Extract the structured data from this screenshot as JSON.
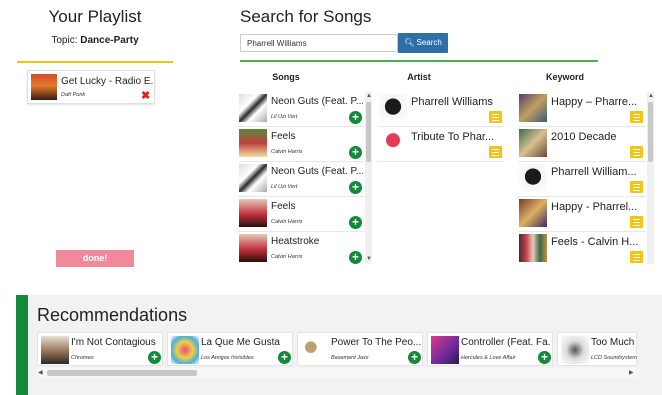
{
  "playlist": {
    "title": "Your Playlist",
    "topic_label": "Topic: ",
    "topic_value": "Dance-Party",
    "items": [
      {
        "title": "Get Lucky - Radio E...",
        "artist": "Daft Punk"
      }
    ],
    "done_label": "done!"
  },
  "search": {
    "title": "Search for Songs",
    "query": "Pharrell Williams",
    "button_label": "Search",
    "columns": {
      "songs": "Songs",
      "artist": "Artist",
      "keyword": "Keyword"
    },
    "songs": [
      {
        "title": "Neon Guts (Feat. P...",
        "artist": "Lil Uzi Vert"
      },
      {
        "title": "Feels",
        "artist": "Calvin Harris"
      },
      {
        "title": "Neon Guts (Feat. P...",
        "artist": "Lil Uzi Vert"
      },
      {
        "title": "Feels",
        "artist": "Calvin Harris"
      },
      {
        "title": "Heatstroke",
        "artist": "Calvin Harris"
      }
    ],
    "artists": [
      {
        "name": "Pharrell Williams"
      },
      {
        "name": "Tribute To Phar..."
      }
    ],
    "keywords": [
      {
        "name": "Happy – Pharre..."
      },
      {
        "name": "2010 Decade"
      },
      {
        "name": "Pharrell William..."
      },
      {
        "name": "Happy - Pharrel..."
      },
      {
        "name": "Feels - Calvin H..."
      }
    ]
  },
  "recommendations": {
    "title": "Recommendations",
    "items": [
      {
        "title": "I'm Not Contagious",
        "artist": "Chromeo"
      },
      {
        "title": "La Que Me Gusta",
        "artist": "Los Amigos Invisibles"
      },
      {
        "title": "Power To The Peo...",
        "artist": "Basement Jaxx"
      },
      {
        "title": "Controller (Feat. Fa...",
        "artist": "Hercules & Love Affair"
      },
      {
        "title": "Too Much L...",
        "artist": "LCD Soundsystem"
      }
    ]
  },
  "colors": {
    "accent_green": "#138a3a",
    "accent_yellow": "#f0c419",
    "search_blue": "#2f6ea8",
    "done_pink": "#f08a9a",
    "remove_red": "#e02020"
  }
}
